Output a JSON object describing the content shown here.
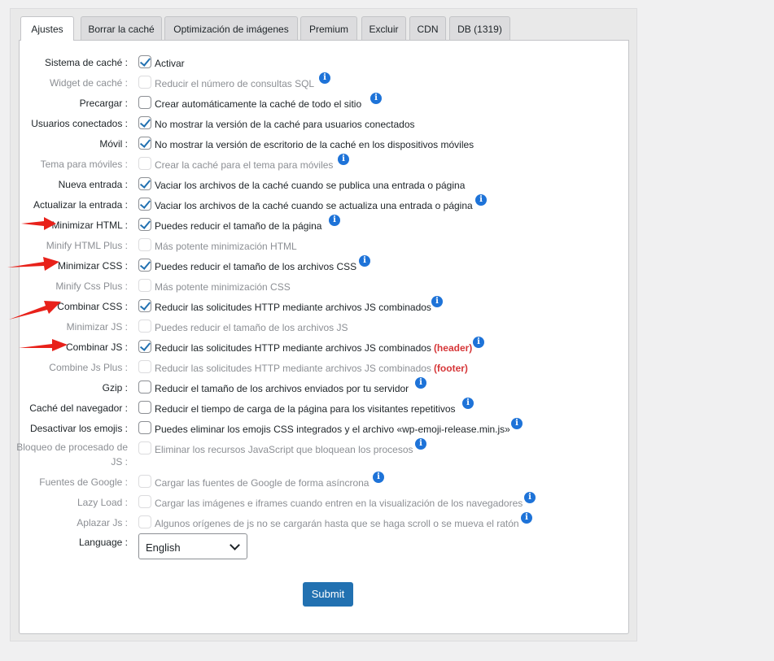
{
  "tabs": [
    {
      "label": "Ajustes",
      "active": true
    },
    {
      "label": "Borrar la caché"
    },
    {
      "label": "Optimización de imágenes"
    },
    {
      "label": "Premium"
    },
    {
      "label": "Excluir"
    },
    {
      "label": "CDN"
    },
    {
      "label": "DB (1319)"
    }
  ],
  "rows": [
    {
      "label": "Sistema de caché :",
      "checked": true,
      "disabled": false,
      "desc": "Activar",
      "info": false
    },
    {
      "label": "Widget de caché :",
      "checked": false,
      "disabled": true,
      "desc": "Reducir el número de consultas SQL",
      "info": true
    },
    {
      "label": "Precargar :",
      "checked": false,
      "disabled": false,
      "desc": "Crear automáticamente la caché de todo el sitio",
      "info": true
    },
    {
      "label": "Usuarios conectados :",
      "checked": true,
      "disabled": false,
      "desc": "No mostrar la versión de la caché para usuarios conectados",
      "info": false
    },
    {
      "label": "Móvil :",
      "checked": true,
      "disabled": false,
      "desc": "No mostrar la versión de escritorio de la caché en los dispositivos móviles",
      "info": false
    },
    {
      "label": "Tema para móviles :",
      "checked": false,
      "disabled": true,
      "desc": "Crear la caché para el tema para móviles",
      "info": true
    },
    {
      "label": "Nueva entrada :",
      "checked": true,
      "disabled": false,
      "desc": "Vaciar los archivos de la caché cuando se publica una entrada o página",
      "info": false
    },
    {
      "label": "Actualizar la entrada :",
      "checked": true,
      "disabled": false,
      "desc": "Vaciar los archivos de la caché cuando se actualiza una entrada o página",
      "info": true
    },
    {
      "label": "Minimizar HTML :",
      "checked": true,
      "disabled": false,
      "desc": "Puedes reducir el tamaño de la página",
      "info": true
    },
    {
      "label": "Minify HTML Plus :",
      "checked": false,
      "disabled": true,
      "desc": "Más potente minimización HTML",
      "info": false
    },
    {
      "label": "Minimizar CSS :",
      "checked": true,
      "disabled": false,
      "desc": "Puedes reducir el tamaño de los archivos CSS",
      "info": true
    },
    {
      "label": "Minify Css Plus :",
      "checked": false,
      "disabled": true,
      "desc": "Más potente minimización CSS",
      "info": false
    },
    {
      "label": "Combinar CSS :",
      "checked": true,
      "disabled": false,
      "desc": "Reducir las solicitudes HTTP mediante archivos JS combinados",
      "info": true
    },
    {
      "label": "Minimizar JS :",
      "checked": false,
      "disabled": true,
      "desc": "Puedes reducir el tamaño de los archivos JS",
      "info": false
    },
    {
      "label": "Combinar JS :",
      "checked": true,
      "disabled": false,
      "desc": "Reducir las solicitudes HTTP mediante archivos JS combinados",
      "tag": "(header)",
      "info": true
    },
    {
      "label": "Combine Js Plus :",
      "checked": false,
      "disabled": true,
      "desc": "Reducir las solicitudes HTTP mediante archivos JS combinados",
      "tag": "(footer)",
      "info": false
    },
    {
      "label": "Gzip :",
      "checked": false,
      "disabled": false,
      "desc": "Reducir el tamaño de los archivos enviados por tu servidor",
      "info": true
    },
    {
      "label": "Caché del navegador :",
      "checked": false,
      "disabled": false,
      "desc": "Reducir el tiempo de carga de la página para los visitantes repetitivos",
      "info": true
    },
    {
      "label": "Desactivar los emojis :",
      "checked": false,
      "disabled": false,
      "desc": "Puedes eliminar los emojis CSS integrados y el archivo «wp-emoji-release.min.js»",
      "info": true
    },
    {
      "label": "Bloqueo de procesado de JS :",
      "checked": false,
      "disabled": true,
      "desc": "Eliminar los recursos JavaScript que bloquean los procesos",
      "info": true
    },
    {
      "label": "Fuentes de Google :",
      "checked": false,
      "disabled": true,
      "desc": "Cargar las fuentes de Google de forma asíncrona",
      "info": true
    },
    {
      "label": "Lazy Load :",
      "checked": false,
      "disabled": true,
      "desc": "Cargar las imágenes e iframes cuando entren en la visualización de los navegadores",
      "info": true
    },
    {
      "label": "Aplazar Js :",
      "checked": false,
      "disabled": true,
      "desc": "Algunos orígenes de js no se cargarán hasta que se haga scroll o se mueva el ratón",
      "info": true
    }
  ],
  "language": {
    "label": "Language :",
    "value": "English"
  },
  "submit_label": "Submit",
  "colors": {
    "primary": "#2271b1",
    "info": "#1e73d8",
    "tag": "#d63638",
    "arrow": "#e8211a"
  }
}
